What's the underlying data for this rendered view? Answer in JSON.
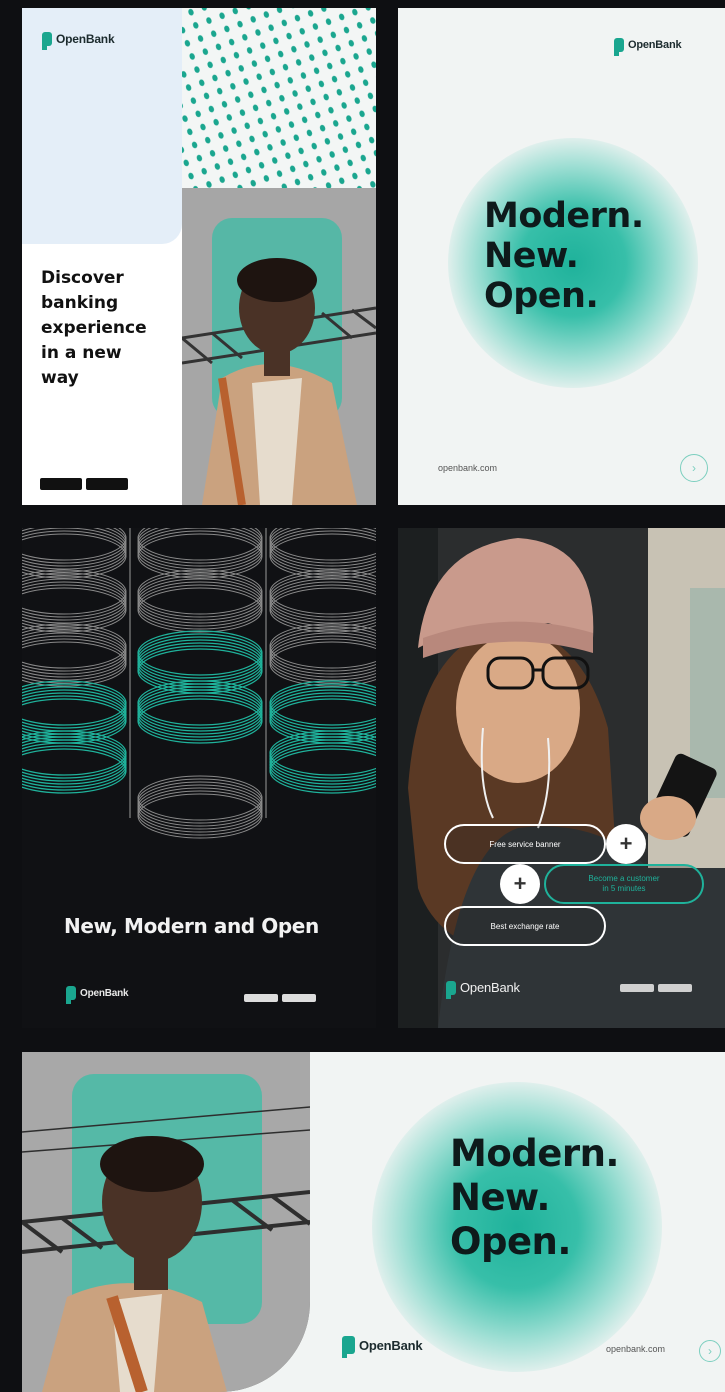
{
  "brand": {
    "name": "OpenBank",
    "url": "openbank.com",
    "colors": {
      "teal": "#1fb29b",
      "dark": "#101114",
      "light": "#f1f4f3",
      "ink": "#0e1a1b"
    }
  },
  "panel1": {
    "logo": "OpenBank",
    "headline": "Discover\nbanking\nexperience\nin a new\nway",
    "store_badges": [
      "google-play-badge",
      "app-store-badge"
    ]
  },
  "panel2": {
    "logo": "OpenBank",
    "headline": "Modern.\nNew.\nOpen.",
    "url": "openbank.com",
    "arrow_icon": "arrow-right-icon"
  },
  "panel3": {
    "title": "New, Modern and Open",
    "logo": "OpenBank"
  },
  "panel4": {
    "pill1": "Free service banner",
    "pill2": "Become a customer\nin 5 minutes",
    "pill3": "Best exchange rate",
    "plus": "+",
    "logo": "OpenBank"
  },
  "panel5": {
    "headline": "Modern.\nNew.\nOpen.",
    "logo": "OpenBank",
    "url": "openbank.com",
    "arrow_icon": "arrow-right-icon"
  }
}
